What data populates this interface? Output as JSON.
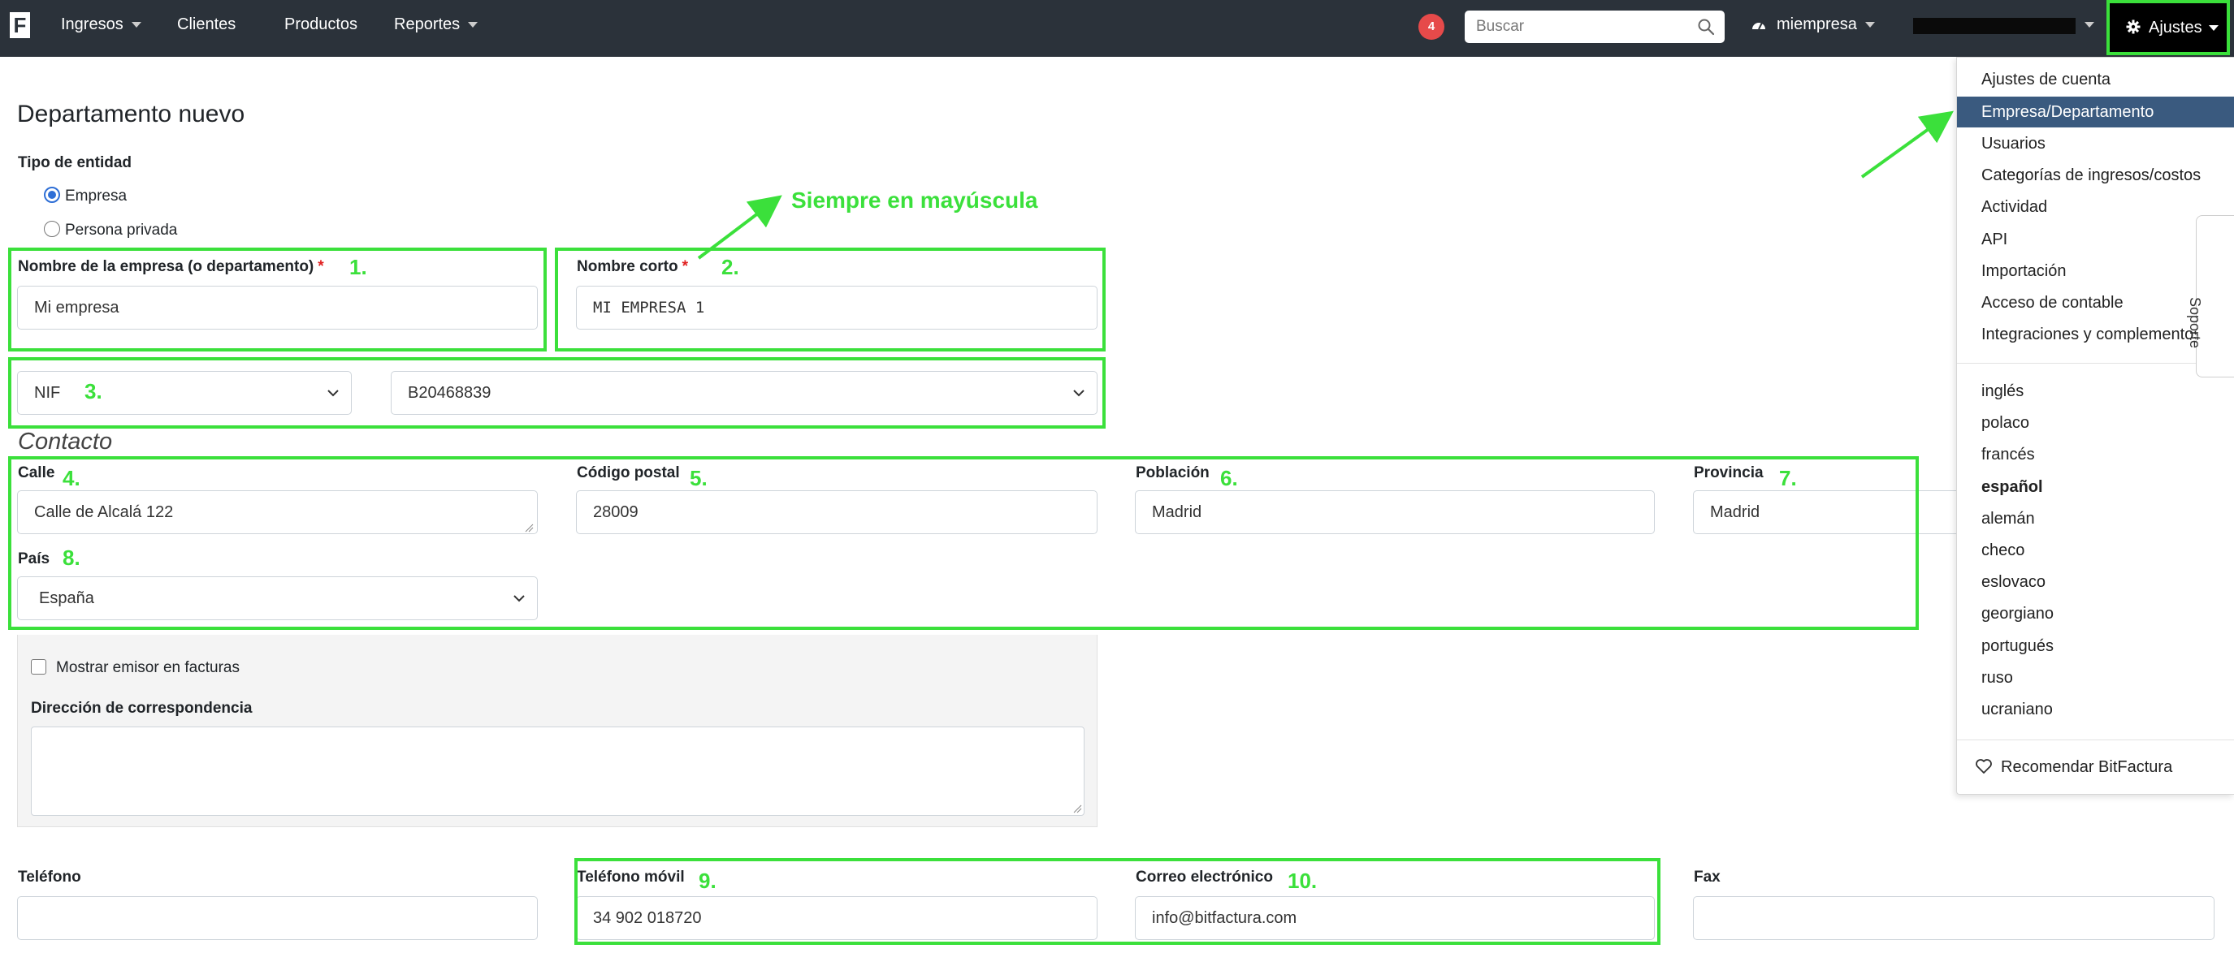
{
  "navbar": {
    "logo": "F",
    "menu": [
      {
        "label": "Ingresos",
        "dropdown": true
      },
      {
        "label": "Clientes",
        "dropdown": false
      },
      {
        "label": "Productos",
        "dropdown": false
      },
      {
        "label": "Reportes",
        "dropdown": true
      }
    ],
    "notification_count": "4",
    "search_placeholder": "Buscar",
    "company_label": "miempresa",
    "settings_label": "Ajustes"
  },
  "form": {
    "title": "Departamento nuevo",
    "entity_type_label": "Tipo de entidad",
    "entity_options": [
      {
        "label": "Empresa",
        "checked": true
      },
      {
        "label": "Persona privada",
        "checked": false
      }
    ],
    "company_name": {
      "label": "Nombre de la empresa (o departamento)",
      "required": "*",
      "value": "Mi empresa"
    },
    "short_name": {
      "label": "Nombre corto",
      "required": "*",
      "value": "MI EMPRESA 1"
    },
    "tax_id_type": "NIF",
    "tax_id_value": "B20468839",
    "contact_title": "Contacto",
    "street": {
      "label": "Calle",
      "value": "Calle de Alcalá 122"
    },
    "postal_code": {
      "label": "Código postal",
      "value": "28009"
    },
    "city": {
      "label": "Población",
      "value": "Madrid"
    },
    "province": {
      "label": "Provincia",
      "value": "Madrid"
    },
    "country": {
      "label": "País",
      "value": "España"
    },
    "show_issuer_label": "Mostrar emisor en facturas",
    "mailing_address_label": "Dirección de correspondencia",
    "phone": {
      "label": "Teléfono",
      "value": ""
    },
    "mobile": {
      "label": "Teléfono móvil",
      "value": "34 902 018720"
    },
    "email": {
      "label": "Correo electrónico",
      "value": "info@bitfactura.com"
    },
    "fax": {
      "label": "Fax",
      "value": ""
    }
  },
  "annotations": {
    "n1": "1.",
    "n2": "2.",
    "n3": "3.",
    "n4": "4.",
    "n5": "5.",
    "n6": "6.",
    "n7": "7.",
    "n8": "8.",
    "n9": "9.",
    "n10": "10.",
    "uppercase_note": "Siempre en mayúscula",
    "color": "#3be03b"
  },
  "settings_menu": {
    "items": [
      "Ajustes de cuenta",
      "Empresa/Departamento",
      "Usuarios",
      "Categorías de ingresos/costos",
      "Actividad",
      "API",
      "Importación",
      "Acceso de contable",
      "Integraciones y complementos"
    ],
    "active_item": "Empresa/Departamento",
    "languages": [
      "inglés",
      "polaco",
      "francés",
      "español",
      "alemán",
      "checo",
      "eslovaco",
      "georgiano",
      "portugués",
      "ruso",
      "ucraniano"
    ],
    "current_language": "español",
    "recommend_label": "Recomendar BitFactura"
  },
  "support_tab": "Soporte",
  "colors": {
    "navbar": "#2b323a",
    "active_menu": "#3a5a7f",
    "badge": "#e64a4a",
    "radio": "#2f6fd6"
  }
}
